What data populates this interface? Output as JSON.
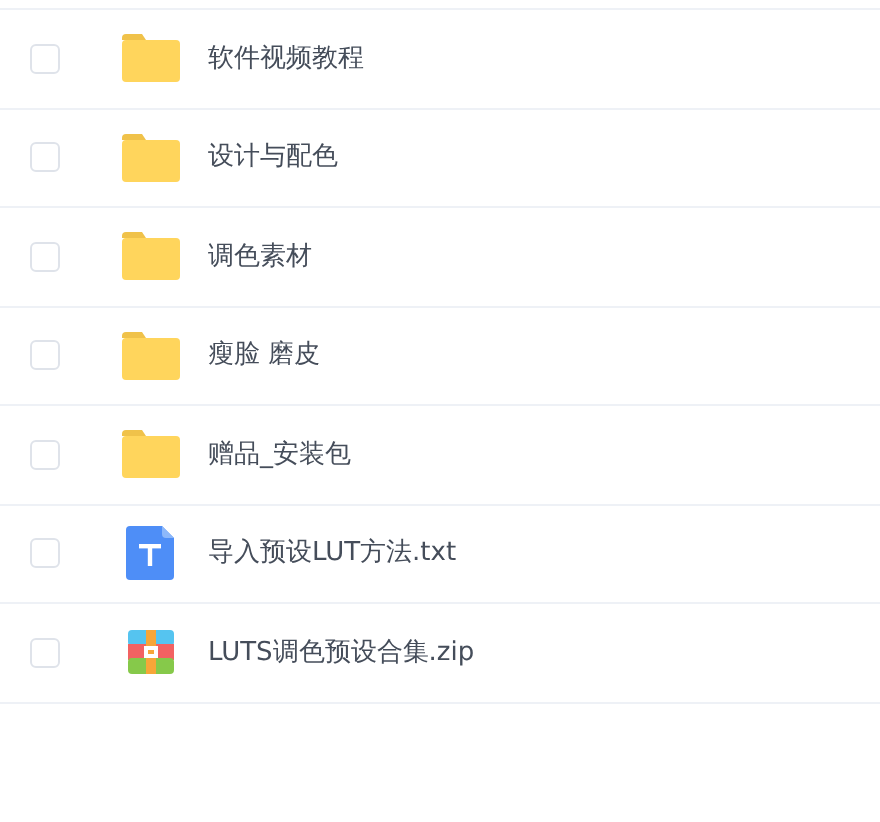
{
  "files": [
    {
      "kind": "folder",
      "name": "软件视频教程",
      "checked": false
    },
    {
      "kind": "folder",
      "name": "设计与配色",
      "checked": false
    },
    {
      "kind": "folder",
      "name": "调色素材",
      "checked": false
    },
    {
      "kind": "folder",
      "name": "瘦脸 磨皮",
      "checked": false
    },
    {
      "kind": "folder",
      "name": "赠品_安装包",
      "checked": false
    },
    {
      "kind": "text",
      "name": "导入预设LUT方法.txt",
      "checked": false
    },
    {
      "kind": "archive",
      "name": "LUTS调色预设合集.zip",
      "checked": false
    }
  ]
}
